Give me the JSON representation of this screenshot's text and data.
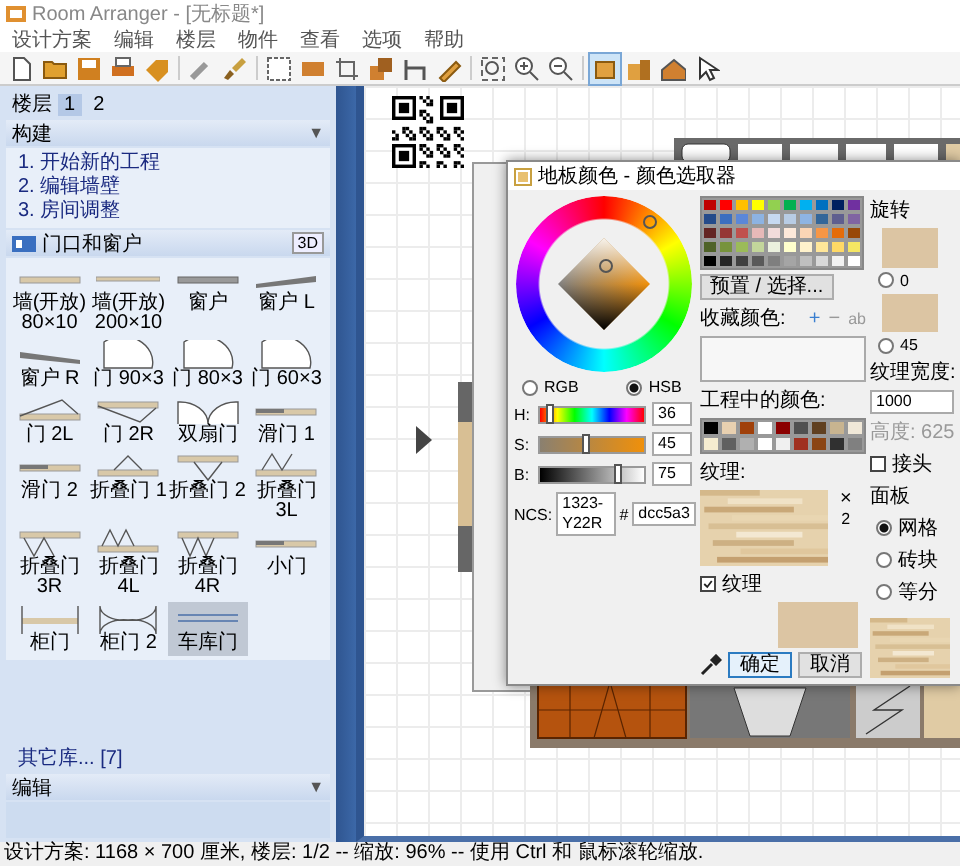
{
  "window": {
    "title": "Room Arranger - [无标题*]"
  },
  "menu": [
    "设计方案",
    "编辑",
    "楼层",
    "物件",
    "查看",
    "选项",
    "帮助"
  ],
  "toolbar": [
    {
      "selected": false
    },
    {
      "selected": false
    },
    {
      "selected": false
    },
    {
      "selected": false
    },
    {
      "selected": false
    },
    {
      "selected": false
    },
    {
      "selected": false
    },
    {
      "selected": false
    },
    {
      "selected": false
    },
    {
      "selected": false
    },
    {
      "selected": false
    },
    {
      "selected": false
    },
    {
      "selected": false
    },
    {
      "selected": false
    },
    {
      "selected": false
    },
    {
      "selected": false
    },
    {
      "selected": true
    },
    {
      "selected": false
    },
    {
      "selected": false
    },
    {
      "selected": false
    }
  ],
  "floors": {
    "label": "楼层",
    "tabs": [
      {
        "label": "1",
        "selected": true
      },
      {
        "label": "2",
        "selected": false
      }
    ]
  },
  "build": {
    "title": "构建",
    "toggle": "▼",
    "steps": [
      "1. 开始新的工程",
      "2. 编辑墙壁",
      "3. 房间调整"
    ]
  },
  "library": {
    "title": "门口和窗户",
    "view_button": "3D",
    "items": [
      {
        "label": "墙(开放) 80×10",
        "kind": "wall",
        "selected": false
      },
      {
        "label": "墙(开放) 200×10",
        "kind": "wall-long",
        "selected": false
      },
      {
        "label": "窗户",
        "kind": "window",
        "selected": false
      },
      {
        "label": "窗户 L",
        "kind": "window-l",
        "selected": false
      },
      {
        "label": "窗户 R",
        "kind": "window-r",
        "selected": false
      },
      {
        "label": "门 90×3",
        "kind": "door",
        "selected": false
      },
      {
        "label": "门 80×3",
        "kind": "door",
        "selected": false
      },
      {
        "label": "门 60×3",
        "kind": "door",
        "selected": false
      },
      {
        "label": "门 2L",
        "kind": "door-up",
        "selected": false
      },
      {
        "label": "门 2R",
        "kind": "door-down",
        "selected": false
      },
      {
        "label": "双扇门",
        "kind": "double",
        "selected": false
      },
      {
        "label": "滑门 1",
        "kind": "slide",
        "selected": false
      },
      {
        "label": "滑门 2",
        "kind": "slide",
        "selected": false
      },
      {
        "label": "折叠门 1",
        "kind": "fold-up",
        "selected": false
      },
      {
        "label": "折叠门 2",
        "kind": "fold-down",
        "selected": false
      },
      {
        "label": "折叠门 3L",
        "kind": "zig-up",
        "selected": false
      },
      {
        "label": "折叠门 3R",
        "kind": "zig-down",
        "selected": false
      },
      {
        "label": "折叠门 4L",
        "kind": "m-up",
        "selected": false
      },
      {
        "label": "折叠门 4R",
        "kind": "w-down",
        "selected": false
      },
      {
        "label": "小门",
        "kind": "slide",
        "selected": false
      },
      {
        "label": "柜门",
        "kind": "cabinet",
        "selected": false
      },
      {
        "label": "柜门 2",
        "kind": "cabinet2",
        "selected": false
      },
      {
        "label": "车库门",
        "kind": "garage",
        "selected": true
      }
    ],
    "more": "其它库... [7]"
  },
  "edit": {
    "title": "编辑",
    "toggle": "▼"
  },
  "dialog": {
    "title": "地板颜色 - 颜色选取器",
    "modes": [
      {
        "label": "RGB",
        "selected": false
      },
      {
        "label": "HSB",
        "selected": true
      }
    ],
    "channels": [
      {
        "name": "H:",
        "value": "36",
        "level": 0.1
      },
      {
        "name": "S:",
        "value": "45",
        "level": 0.45
      },
      {
        "name": "B:",
        "value": "75",
        "level": 0.75
      }
    ],
    "ncs": {
      "label": "NCS:",
      "value": "1323-Y22R"
    },
    "hex": {
      "label": "#",
      "value": "dcc5a3"
    },
    "palette": [
      {
        "color": "#c00000"
      },
      {
        "color": "#ff0000"
      },
      {
        "color": "#ffc000"
      },
      {
        "color": "#ffff00"
      },
      {
        "color": "#92d050"
      },
      {
        "color": "#00b050"
      },
      {
        "color": "#00b0f0"
      },
      {
        "color": "#0070c0"
      },
      {
        "color": "#002060"
      },
      {
        "color": "#7030a0"
      },
      {
        "color": "#244b8a"
      },
      {
        "color": "#3b6ebf"
      },
      {
        "color": "#5b87d8"
      },
      {
        "color": "#8db3e2"
      },
      {
        "color": "#c6d9f1"
      },
      {
        "color": "#b8cce4"
      },
      {
        "color": "#8eb4e3"
      },
      {
        "color": "#336699"
      },
      {
        "color": "#5f5f8f"
      },
      {
        "color": "#8064a2"
      },
      {
        "color": "#632523"
      },
      {
        "color": "#953735"
      },
      {
        "color": "#c0504d"
      },
      {
        "color": "#e6b9b8"
      },
      {
        "color": "#f2dcdb"
      },
      {
        "color": "#fde9d9"
      },
      {
        "color": "#fbd5b5"
      },
      {
        "color": "#f79646"
      },
      {
        "color": "#e46c0a"
      },
      {
        "color": "#984807"
      },
      {
        "color": "#4f6228"
      },
      {
        "color": "#77933c"
      },
      {
        "color": "#9bbb59"
      },
      {
        "color": "#c3d69b"
      },
      {
        "color": "#ebf1de"
      },
      {
        "color": "#ffffcc"
      },
      {
        "color": "#fff2cc"
      },
      {
        "color": "#ffe699"
      },
      {
        "color": "#ffd966"
      },
      {
        "color": "#f5e663"
      },
      {
        "color": "#000000"
      },
      {
        "color": "#262626"
      },
      {
        "color": "#404040"
      },
      {
        "color": "#595959"
      },
      {
        "color": "#7f7f7f"
      },
      {
        "color": "#a5a5a5"
      },
      {
        "color": "#bfbfbf"
      },
      {
        "color": "#d9d9d9"
      },
      {
        "color": "#f2f2f2"
      },
      {
        "color": "#ffffff"
      }
    ],
    "preset_button": "预置 / 选择...",
    "favorites": {
      "label": "收藏颜色:",
      "add": "+",
      "remove": "−",
      "rename": "ab"
    },
    "project_colors": {
      "label": "工程中的颜色:",
      "colors": [
        {
          "color": "#000000"
        },
        {
          "color": "#e8d0b0"
        },
        {
          "color": "#a0400a"
        },
        {
          "color": "#ffffff"
        },
        {
          "color": "#8b0000"
        },
        {
          "color": "#505050"
        },
        {
          "color": "#604020"
        },
        {
          "color": "#c8b490"
        },
        {
          "color": "#f0e8d8"
        },
        {
          "color": "#f5ecd0"
        },
        {
          "color": "#606060"
        },
        {
          "color": "#b0b0b0"
        },
        {
          "color": "#ffffff"
        },
        {
          "color": "#f0f0f0"
        },
        {
          "color": "#a03020"
        },
        {
          "color": "#8b4513"
        },
        {
          "color": "#303030"
        },
        {
          "color": "#808080"
        }
      ]
    },
    "texture": {
      "label": "纹理:",
      "remove": "×",
      "count": "2"
    },
    "use_texture": {
      "label": "纹理",
      "checked": true
    },
    "preview": {
      "color": "#dcc5a3"
    },
    "buttons": [
      {
        "label": "确定",
        "default": true
      },
      {
        "label": "取消",
        "default": false
      }
    ],
    "rotation": {
      "label": "旋转",
      "options": [
        {
          "label": "0",
          "selected": false
        },
        {
          "label": "45",
          "selected": false
        }
      ]
    },
    "texture_width": {
      "label": "纹理宽度:",
      "value": "1000"
    },
    "texture_height": "高度: 625",
    "joint": {
      "label": "接头",
      "checked": false
    },
    "pattern": {
      "label": "面板",
      "options": [
        {
          "label": "网格",
          "selected": true
        },
        {
          "label": "砖块",
          "selected": false
        },
        {
          "label": "等分",
          "selected": false
        }
      ]
    }
  },
  "status_bar": "设计方案: 1168 × 700 厘米, 楼层: 1/2 -- 缩放: 96% -- 使用 Ctrl 和 鼠标滚轮缩放."
}
